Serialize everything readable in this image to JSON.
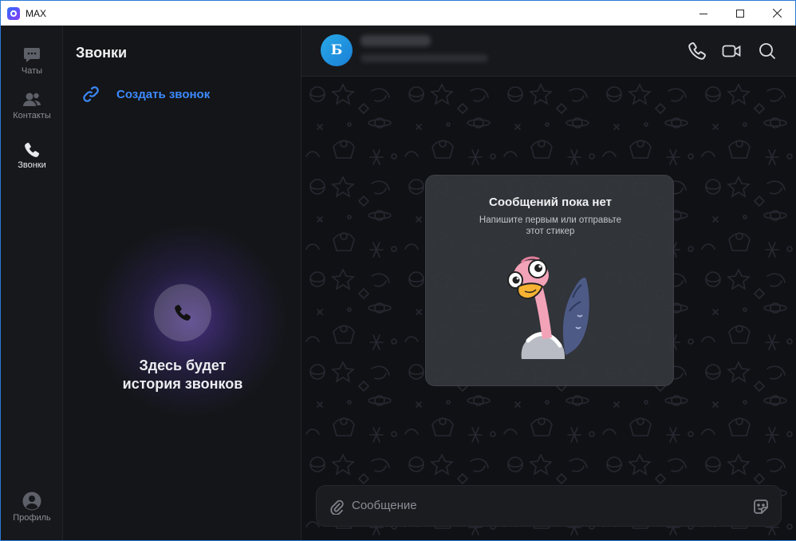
{
  "window": {
    "title": "MAX"
  },
  "rail": {
    "items": [
      {
        "label": "Чаты",
        "icon": "chat-bubble-icon"
      },
      {
        "label": "Контакты",
        "icon": "contacts-icon"
      },
      {
        "label": "Звонки",
        "icon": "phone-icon",
        "active": true
      }
    ],
    "profile": {
      "label": "Профиль",
      "icon": "profile-icon"
    }
  },
  "calls": {
    "title": "Звонки",
    "create_call_label": "Создать звонок",
    "empty_line1": "Здесь будет",
    "empty_line2": "история звонков"
  },
  "chat": {
    "avatar_letter": "Б",
    "empty_title": "Сообщений пока нет",
    "empty_subtitle_line1": "Напишите первым или отправьте",
    "empty_subtitle_line2": "этот стикер",
    "composer_placeholder": "Сообщение"
  },
  "colors": {
    "accent": "#3c8bff",
    "background": "#101114",
    "panel": "#141518"
  }
}
